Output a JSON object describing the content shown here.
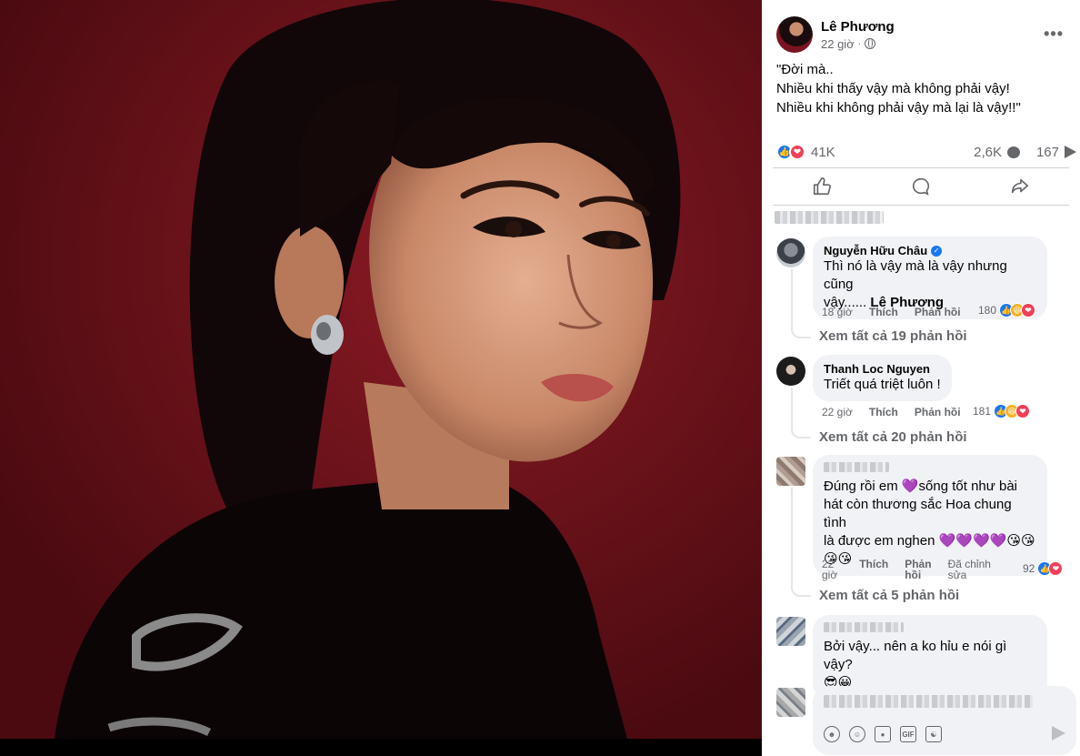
{
  "post": {
    "author": "Lê Phương",
    "time": "22 giờ",
    "text_lines": [
      "\"Đời mà..",
      "Nhiều khi thấy vậy mà không phải vậy!",
      "Nhiều khi không phải vậy mà lại là vậy!!\""
    ],
    "reactions_count": "41K",
    "comments_count": "2,6K",
    "shares_count": "167"
  },
  "comments": [
    {
      "name": "Nguyễn Hữu Châu",
      "text_line1": "Thì nó là vậy mà là vậy nhưng cũng",
      "text_line2": "vậy...... ",
      "mention": "Lê Phương",
      "time": "18 giờ",
      "like": "Thích",
      "reply": "Phản hồi",
      "react_count": "180",
      "view_replies": "Xem tất cả 19 phản hồi"
    },
    {
      "name": "Thanh Loc Nguyen",
      "text_line1": "Triết quá triệt luôn !",
      "time": "22 giờ",
      "like": "Thích",
      "reply": "Phản hồi",
      "react_count": "181",
      "view_replies": "Xem tất cả 20 phản hồi"
    },
    {
      "text_line1": "Đúng rồi em 💜sống tốt như bài",
      "text_line2": "hát còn thương sắc Hoa chung tình",
      "text_line3": "là được em nghen 💜💜💜💜😘😘",
      "text_line4": "😘😘",
      "time_a": "22",
      "time_b": "giờ",
      "like": "Thích",
      "reply_a": "Phản",
      "reply_b": "hồi",
      "edited_a": "Đã chỉnh",
      "edited_b": "sửa",
      "react_count": "92",
      "view_replies": "Xem tất cả 5 phản hồi"
    },
    {
      "text_line1": "Bởi vậy... nên a ko hỉu e nói gì vậy?",
      "text_line2": "😎😀"
    }
  ],
  "colors": {
    "like_blue": "#1877f2",
    "love_red": "#f33e58",
    "haha_yellow": "#f7b125",
    "secondary_text": "#65676b",
    "bubble_bg": "#f0f2f5"
  },
  "icons": [
    "globe-icon",
    "more-icon",
    "like-icon",
    "comment-icon",
    "share-icon",
    "send-icon",
    "sticker-icon",
    "emoji-icon",
    "camera-icon",
    "gif-icon"
  ]
}
